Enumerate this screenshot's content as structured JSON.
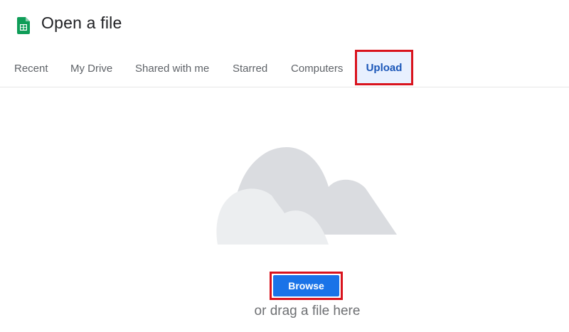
{
  "header": {
    "title": "Open a file",
    "icon": "sheets-icon"
  },
  "tabs": [
    {
      "label": "Recent"
    },
    {
      "label": "My Drive"
    },
    {
      "label": "Shared with me"
    },
    {
      "label": "Starred"
    },
    {
      "label": "Computers"
    },
    {
      "label": "Upload",
      "selected": true
    }
  ],
  "upload": {
    "browse_label": "Browse",
    "drag_text": "or drag a file here",
    "illustration": "cloud-icon"
  },
  "colors": {
    "accent": "#1a73e8",
    "selected_tab_bg": "#e8f0fe",
    "selected_tab_text": "#1a56b8",
    "highlight_box": "#d9131d",
    "sheets_green": "#0f9d58"
  }
}
